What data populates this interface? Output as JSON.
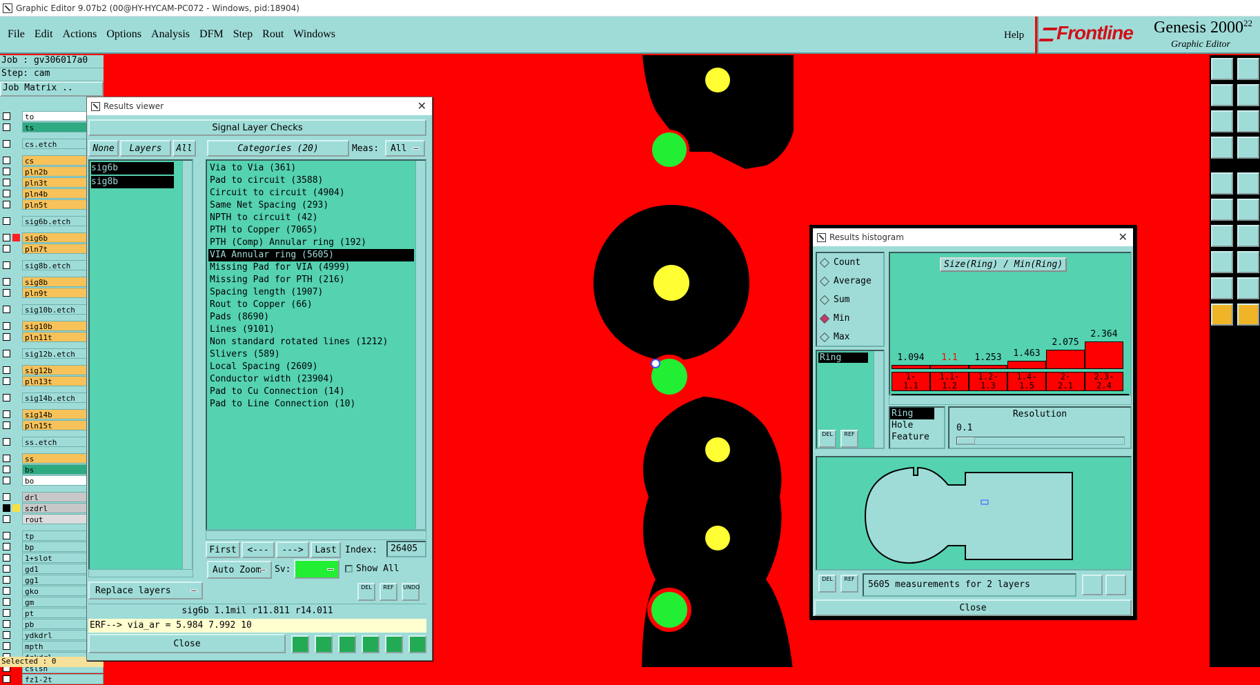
{
  "titlebar": {
    "text": "Graphic Editor 9.07b2 (00@HY-HYCAM-PC072 - Windows, pid:18904)"
  },
  "menubar": {
    "items": [
      "File",
      "Edit",
      "Actions",
      "Options",
      "Analysis",
      "DFM",
      "Step",
      "Rout",
      "Windows"
    ],
    "help": "Help"
  },
  "brand": {
    "logo_text": "Frontline",
    "product": "Genesis 2000",
    "version_sup": "22",
    "subtitle": "Graphic Editor"
  },
  "left_panel": {
    "job": "Job : gv306017a0",
    "step": "Step: cam",
    "job_matrix": "Job Matrix ..",
    "selected": "Selected : 0",
    "layers": [
      {
        "name": "to",
        "color": "#ffffff"
      },
      {
        "name": "ts",
        "color": "#2eaa80"
      },
      {
        "sep": true
      },
      {
        "name": "cs.etch",
        "color": "#9fdcd8"
      },
      {
        "sep": true
      },
      {
        "name": "cs",
        "color": "#f7c25a"
      },
      {
        "name": "pln2b",
        "color": "#f7c25a"
      },
      {
        "name": "pln3t",
        "color": "#f7c25a"
      },
      {
        "name": "pln4b",
        "color": "#f7c25a"
      },
      {
        "name": "pln5t",
        "color": "#f7c25a"
      },
      {
        "sep": true
      },
      {
        "name": "sig6b.etch",
        "color": "#9fdcd8"
      },
      {
        "sep": true
      },
      {
        "name": "sig6b",
        "color": "#f7c25a",
        "swatch": "#ff2020"
      },
      {
        "name": "pln7t",
        "color": "#f7c25a"
      },
      {
        "sep": true
      },
      {
        "name": "sig8b.etch",
        "color": "#9fdcd8"
      },
      {
        "sep": true
      },
      {
        "name": "sig8b",
        "color": "#f7c25a"
      },
      {
        "name": "pln9t",
        "color": "#f7c25a"
      },
      {
        "sep": true
      },
      {
        "name": "sig10b.etch",
        "color": "#9fdcd8"
      },
      {
        "sep": true
      },
      {
        "name": "sig10b",
        "color": "#f7c25a"
      },
      {
        "name": "pln11t",
        "color": "#f7c25a"
      },
      {
        "sep": true
      },
      {
        "name": "sig12b.etch",
        "color": "#9fdcd8"
      },
      {
        "sep": true
      },
      {
        "name": "sig12b",
        "color": "#f7c25a"
      },
      {
        "name": "pln13t",
        "color": "#f7c25a"
      },
      {
        "sep": true
      },
      {
        "name": "sig14b.etch",
        "color": "#9fdcd8"
      },
      {
        "sep": true
      },
      {
        "name": "sig14b",
        "color": "#f7c25a"
      },
      {
        "name": "pln15t",
        "color": "#f7c25a"
      },
      {
        "sep": true
      },
      {
        "name": "ss.etch",
        "color": "#9fdcd8"
      },
      {
        "sep": true
      },
      {
        "name": "ss",
        "color": "#f7c25a"
      },
      {
        "name": "bs",
        "color": "#2eaa80"
      },
      {
        "name": "bo",
        "color": "#ffffff"
      },
      {
        "sep": true
      },
      {
        "name": "drl",
        "color": "#c8c8c8"
      },
      {
        "name": "szdrl",
        "color": "#c8c8c8",
        "swatch": "#f7e040",
        "checked": true
      },
      {
        "name": "rout",
        "color": "#dcdcdc"
      },
      {
        "sep": true
      },
      {
        "name": "tp",
        "color": "#9fdcd8"
      },
      {
        "name": "bp",
        "color": "#9fdcd8"
      },
      {
        "name": "1+slot",
        "color": "#9fdcd8"
      },
      {
        "name": "gd1",
        "color": "#9fdcd8"
      },
      {
        "name": "gg1",
        "color": "#9fdcd8"
      },
      {
        "name": "gko",
        "color": "#9fdcd8"
      },
      {
        "name": "gm",
        "color": "#9fdcd8"
      },
      {
        "name": "pt",
        "color": "#9fdcd8"
      },
      {
        "name": "pb",
        "color": "#9fdcd8"
      },
      {
        "name": "ydkdrl",
        "color": "#9fdcd8"
      },
      {
        "name": "mpth",
        "color": "#9fdcd8"
      },
      {
        "name": "fzkdrl",
        "color": "#9fdcd8"
      },
      {
        "name": "cslsh",
        "color": "#9fdcd8"
      },
      {
        "name": "fz1-2t",
        "color": "#9fdcd8"
      }
    ]
  },
  "results_viewer": {
    "title": "Results viewer",
    "header": "Signal Layer Checks",
    "btn_none": "None",
    "btn_layers": "Layers",
    "btn_all": "All",
    "categories_label": "Categories (20)",
    "meas_label": "Meas:",
    "meas_value": "All",
    "layers": [
      "sig6b",
      "sig8b"
    ],
    "categories": [
      "Via to Via (361)",
      "Pad to circuit (3588)",
      "Circuit to circuit (4904)",
      "Same Net Spacing (293)",
      "NPTH to circuit (42)",
      "PTH to Copper (7065)",
      "PTH (Comp) Annular ring (192)",
      "VIA Annular ring (5605)",
      "Missing Pad for VIA (4999)",
      "Missing Pad for PTH (216)",
      "Spacing length (1907)",
      "Rout to Copper (66)",
      "Pads (8690)",
      "Lines (9101)",
      "Non standard rotated lines (1212)",
      "Slivers (589)",
      "Local Spacing (2609)",
      "Conductor width (23904)",
      "Pad to Cu Connection (14)",
      "Pad to Line Connection (10)"
    ],
    "selected_category_index": 7,
    "btn_first": "First",
    "btn_prev": "<---",
    "btn_next": "--->",
    "btn_last": "Last",
    "index_label": "Index:",
    "index_value": "26405",
    "auto_zoom": "Auto Zoom",
    "sv_label": "Sv:",
    "show_all": "Show All",
    "replace_layers": "Replace layers",
    "btn_del": "DEL",
    "btn_ref": "REF",
    "btn_undo": "UNDO",
    "info_line": "sig6b 1.1mil  r11.811  r14.011",
    "erf_line": "ERF--> via_ar = 5.984 7.992 10",
    "close": "Close"
  },
  "histogram": {
    "title": "Results histogram",
    "modes": [
      "Count",
      "Average",
      "Sum",
      "Min",
      "Max"
    ],
    "selected_mode": "Min",
    "chart_title": "Size(Ring) / Min(Ring)",
    "list_item": "Ring",
    "bars": [
      {
        "value": "1.094",
        "range": "1-\n1.1",
        "level": 0.06
      },
      {
        "value": "1.1",
        "range": "1.1-\n1.2",
        "level": 0.06,
        "highlight": true
      },
      {
        "value": "1.253",
        "range": "1.2-\n1.3",
        "level": 0.15
      },
      {
        "value": "1.463",
        "range": "1.4-\n1.5",
        "level": 0.3
      },
      {
        "value": "2.075",
        "range": "2-\n2.1",
        "level": 0.7
      },
      {
        "value": "2.364",
        "range": "2.3-\n2.4",
        "level": 1.0
      }
    ],
    "attr_list": [
      "Ring",
      "Hole",
      "Feature"
    ],
    "resolution_label": "Resolution",
    "resolution_value": "0.1",
    "btn_del": "DEL",
    "btn_ref": "REF",
    "summary": "5605 measurements for 2 layers",
    "close": "Close"
  },
  "colors": {
    "canvas": "#ff0000",
    "copper": "#000000",
    "pad_yellow": "#ffff33",
    "pad_green": "#22ee33",
    "panel": "#9fdcd8",
    "list_green": "#55d2b0"
  }
}
